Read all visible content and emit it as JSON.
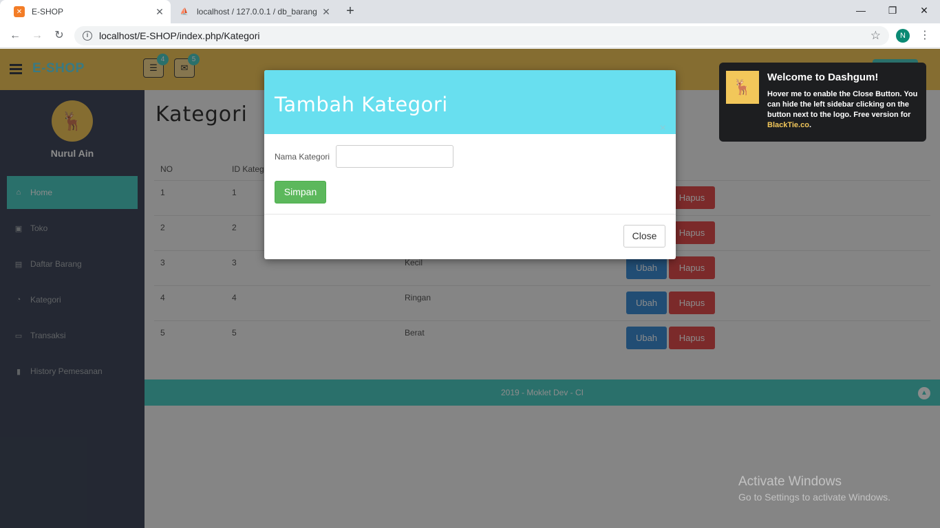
{
  "browser": {
    "tabs": [
      {
        "title": "E-SHOP",
        "active": true
      },
      {
        "title": "localhost / 127.0.0.1 / db_barang",
        "active": false
      }
    ],
    "url": "localhost/E-SHOP/index.php/Kategori",
    "profile_initial": "N"
  },
  "header": {
    "brand": "E-SHOP",
    "badge_tasks": "4",
    "badge_mail": "5"
  },
  "sidebar": {
    "username": "Nurul Ain",
    "items": [
      {
        "label": "Home",
        "icon": "home-icon"
      },
      {
        "label": "Toko",
        "icon": "briefcase-icon"
      },
      {
        "label": "Daftar Barang",
        "icon": "list-icon"
      },
      {
        "label": "Kategori",
        "icon": "dashboard-icon"
      },
      {
        "label": "Transaksi",
        "icon": "money-icon"
      },
      {
        "label": "History Pemesanan",
        "icon": "bookmark-icon"
      }
    ]
  },
  "main": {
    "title": "Kategori",
    "table": {
      "headers": [
        "NO",
        "ID Kategori"
      ],
      "rows": [
        {
          "no": "1",
          "id": "1",
          "name": ""
        },
        {
          "no": "2",
          "id": "2",
          "name": ""
        },
        {
          "no": "3",
          "id": "3",
          "name": "Kecil"
        },
        {
          "no": "4",
          "id": "4",
          "name": "Ringan"
        },
        {
          "no": "5",
          "id": "5",
          "name": "Berat"
        }
      ],
      "edit_label": "Ubah",
      "delete_label": "Hapus"
    }
  },
  "footer": {
    "text": "2019 - Moklet Dev - CI"
  },
  "modal": {
    "title": "Tambah Kategori",
    "field_label": "Nama Kategori",
    "field_value": "",
    "submit_label": "Simpan",
    "close_label": "Close",
    "close_x": "×"
  },
  "notification": {
    "title": "Welcome to Dashgum!",
    "text": "Hover me to enable the Close Button. You can hide the left sidebar clicking on the button next to the logo. Free version for ",
    "link": "BlackTie.co",
    "suffix": "."
  },
  "watermark": {
    "line1": "Activate Windows",
    "line2": "Go to Settings to activate Windows."
  },
  "colors": {
    "header": "#f2c75a",
    "accent": "#4ecdc4",
    "modal_header": "#68dfef",
    "sidebar": "#424a5d"
  }
}
